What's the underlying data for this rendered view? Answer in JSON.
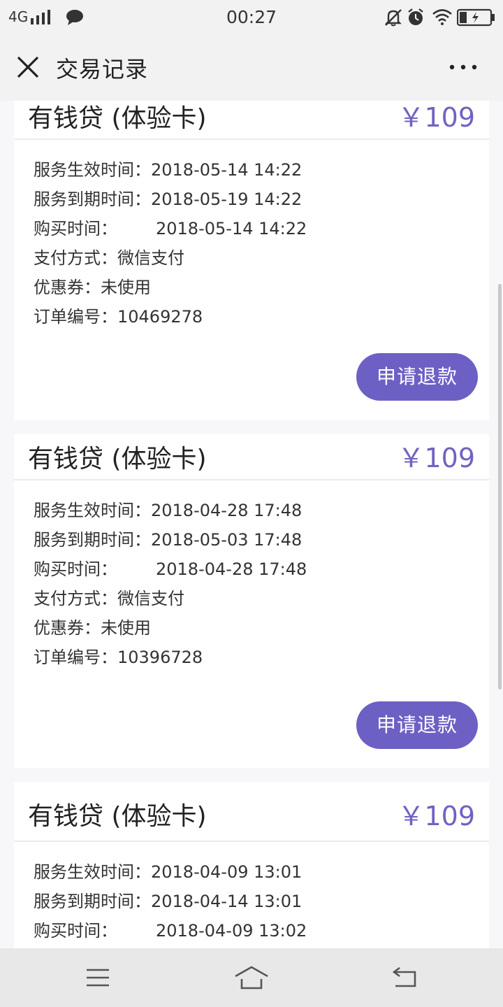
{
  "status_bar": {
    "network": "4G",
    "time": "00:27"
  },
  "header": {
    "title": "交易记录"
  },
  "records": [
    {
      "name": "有钱贷 (体验卡)",
      "price": "￥109",
      "fields": [
        {
          "label": "服务生效时间：",
          "value": "2018-05-14 14:22"
        },
        {
          "label": "服务到期时间：",
          "value": "2018-05-19 14:22"
        },
        {
          "label": "购买时间：",
          "value": "2018-05-14 14:22"
        },
        {
          "label": "支付方式：",
          "value": "微信支付"
        },
        {
          "label": "优惠券：",
          "value": "未使用"
        },
        {
          "label": "订单编号：",
          "value": "10469278"
        }
      ],
      "button": "申请退款"
    },
    {
      "name": "有钱贷 (体验卡)",
      "price": "￥109",
      "fields": [
        {
          "label": "服务生效时间：",
          "value": "2018-04-28 17:48"
        },
        {
          "label": "服务到期时间：",
          "value": "2018-05-03 17:48"
        },
        {
          "label": "购买时间：",
          "value": "2018-04-28 17:48"
        },
        {
          "label": "支付方式：",
          "value": "微信支付"
        },
        {
          "label": "优惠券：",
          "value": "未使用"
        },
        {
          "label": "订单编号：",
          "value": "10396728"
        }
      ],
      "button": "申请退款"
    },
    {
      "name": "有钱贷 (体验卡)",
      "price": "￥109",
      "fields": [
        {
          "label": "服务生效时间：",
          "value": "2018-04-09 13:01"
        },
        {
          "label": "服务到期时间：",
          "value": "2018-04-14 13:01"
        },
        {
          "label": "购买时间：",
          "value": "2018-04-09 13:02"
        }
      ]
    }
  ],
  "colors": {
    "accent": "#6d60c4",
    "price": "#7262c2",
    "background": "#f7f7f9"
  },
  "icons": [
    "signal-icon",
    "chat-icon",
    "mute-icon",
    "alarm-icon",
    "wifi-icon",
    "battery-icon",
    "close-icon",
    "more-icon",
    "menu-icon",
    "home-icon",
    "back-icon"
  ]
}
